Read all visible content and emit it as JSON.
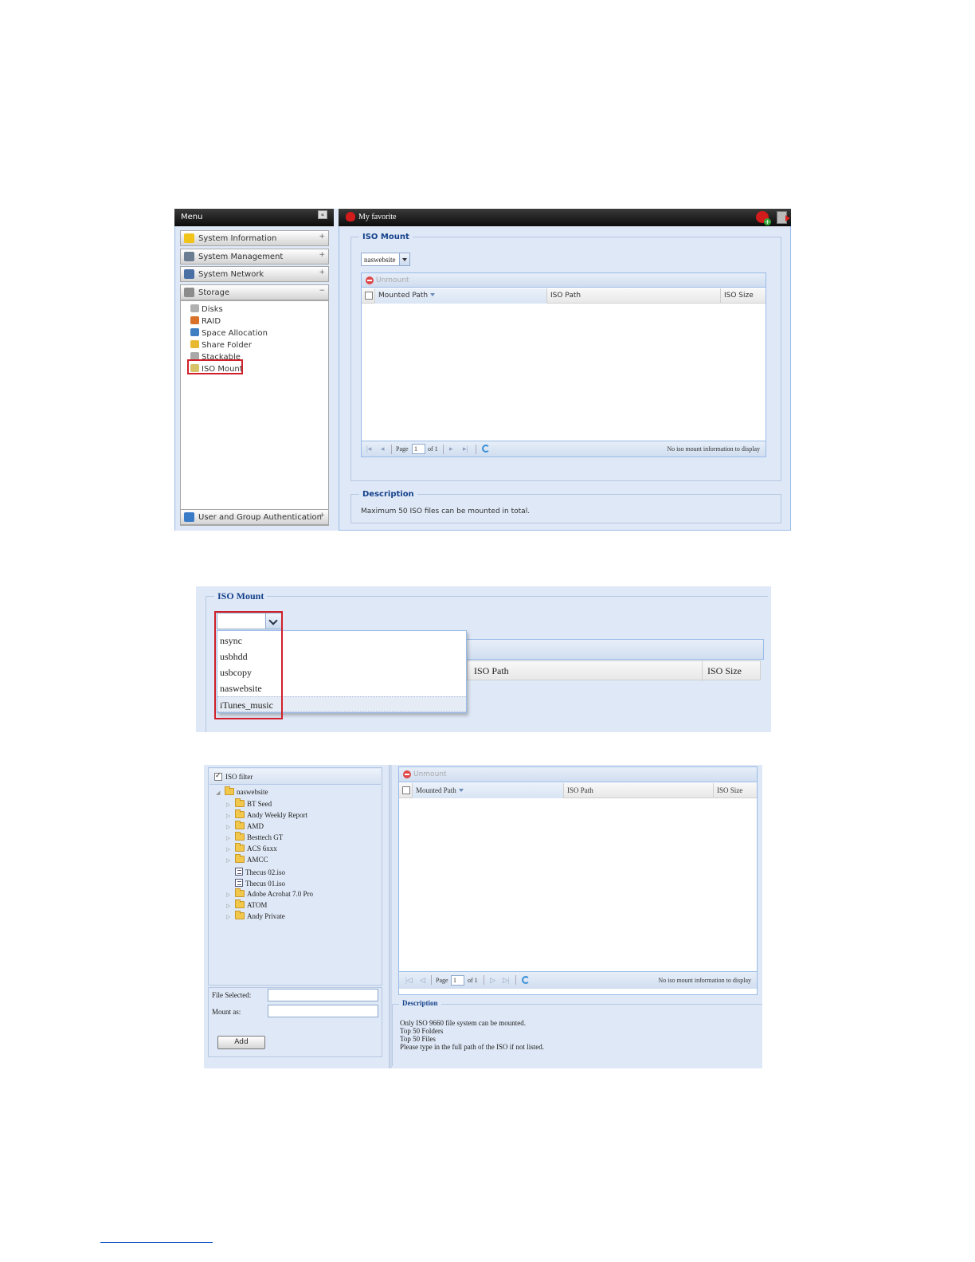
{
  "shot1": {
    "menu_title": "Menu",
    "collapse_glyph": "«",
    "fav_title": "My favorite",
    "accordion": [
      {
        "label": "System Information",
        "glyph": "+",
        "icon_color": "#f0c419"
      },
      {
        "label": "System Management",
        "glyph": "+",
        "icon_color": "#6b7d91"
      },
      {
        "label": "System Network",
        "glyph": "+",
        "icon_color": "#4a6fa5"
      },
      {
        "label": "Storage",
        "glyph": "−",
        "icon_color": "#8c8c8c"
      }
    ],
    "storage_items": [
      {
        "label": "Disks",
        "icon_color": "#b0b0b0"
      },
      {
        "label": "RAID",
        "icon_color": "#d9712b"
      },
      {
        "label": "Space Allocation",
        "icon_color": "#3f7fc2"
      },
      {
        "label": "Share Folder",
        "icon_color": "#e8b830"
      },
      {
        "label": "Stackable",
        "icon_color": "#a9a9a9"
      },
      {
        "label": "ISO Mount",
        "icon_color": "#d8c36a"
      }
    ],
    "bottom_accordion": {
      "label": "User and Group Authentication",
      "glyph": "+",
      "icon_color": "#3a7bc8"
    },
    "iso_panel": {
      "legend": "ISO Mount",
      "combo_value": "naswebsite",
      "unmount_label": "Unmount",
      "columns": [
        "Mounted Path",
        "ISO Path",
        "ISO Size"
      ],
      "page_label": "Page",
      "page_value": "1",
      "of_label": "of 1",
      "empty_msg": "No iso mount information to display"
    },
    "description": {
      "legend": "Description",
      "text": "Maximum 50 ISO files can be mounted in total."
    }
  },
  "shot2": {
    "legend": "ISO Mount",
    "options": [
      "nsync",
      "usbhdd",
      "usbcopy",
      "naswebsite",
      "iTunes_music"
    ],
    "selected_index": 4,
    "columns": [
      "ISO Path",
      "ISO Size"
    ]
  },
  "shot3": {
    "filter_label": "ISO filter",
    "root_label": "naswebsite",
    "tree": [
      {
        "label": "BT Seed",
        "type": "folder"
      },
      {
        "label": "Andy Weekly Report",
        "type": "folder"
      },
      {
        "label": "AMD",
        "type": "folder"
      },
      {
        "label": "Besttech GT",
        "type": "folder"
      },
      {
        "label": "ACS 6xxx",
        "type": "folder"
      },
      {
        "label": "AMCC",
        "type": "folder"
      },
      {
        "label": "Thecus 02.iso",
        "type": "file"
      },
      {
        "label": "Thecus 01.iso",
        "type": "file"
      },
      {
        "label": "Adobe Acrobat 7.0 Pro",
        "type": "folder"
      },
      {
        "label": "ATOM",
        "type": "folder"
      },
      {
        "label": "Andy Private",
        "type": "folder"
      }
    ],
    "file_selected_label": "File Selected:",
    "mount_as_label": "Mount as:",
    "add_label": "Add",
    "unmount_label": "Unmount",
    "columns": [
      "Mounted Path",
      "ISO Path",
      "ISO Size"
    ],
    "page_label": "Page",
    "page_value": "1",
    "of_label": "of 1",
    "empty_msg": "No iso mount information to display",
    "description": {
      "legend": "Description",
      "lines": [
        "Only ISO 9660 file system can be mounted.",
        "Top 50 Folders",
        "Top 50 Files",
        "Please type in the full path of the ISO if not listed."
      ]
    }
  },
  "colors": {
    "panel_bg": "#dfe8f6",
    "panel_border": "#99bbe8",
    "legend_text": "#15428b",
    "highlight_red": "#d0202a"
  }
}
